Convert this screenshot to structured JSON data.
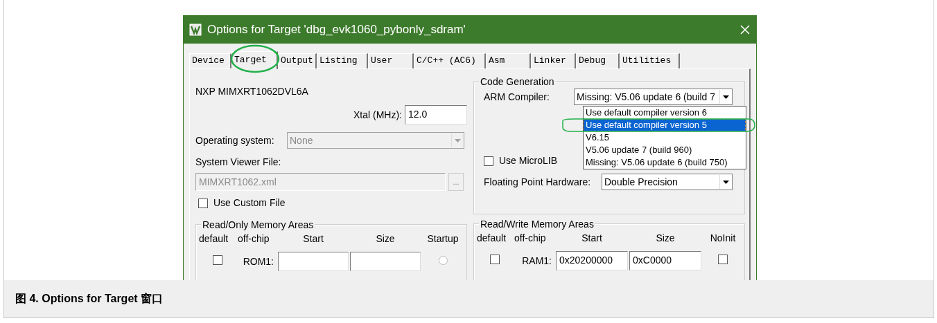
{
  "dialog": {
    "title": "Options for Target 'dbg_evk1060_pybonly_sdram'",
    "tabs": [
      {
        "label": "Device",
        "selected": false
      },
      {
        "label": "Target",
        "selected": true
      },
      {
        "label": "Output",
        "selected": false
      },
      {
        "label": "Listing",
        "selected": false
      },
      {
        "label": "User",
        "selected": false
      },
      {
        "label": "C/C++ (AC6)",
        "selected": false
      },
      {
        "label": "Asm",
        "selected": false
      },
      {
        "label": "Linker",
        "selected": false
      },
      {
        "label": "Debug",
        "selected": false
      },
      {
        "label": "Utilities",
        "selected": false
      }
    ],
    "device": "NXP MIMXRT1062DVL6A",
    "xtal": {
      "label": "Xtal (MHz):",
      "value": "12.0"
    },
    "operating_system": {
      "label": "Operating system:",
      "value": "None",
      "disabled": true
    },
    "system_viewer": {
      "label": "System Viewer File:",
      "value": "MIMXRT1062.xml",
      "disabled": true,
      "browse": "..."
    },
    "use_custom_file": {
      "label": "Use Custom File",
      "checked": false
    },
    "code_generation": {
      "title": "Code Generation",
      "arm_compiler": {
        "label": "ARM Compiler:",
        "value": "Missing: V5.06 update 6 (build 7",
        "options": [
          {
            "label": "Use default compiler version 6",
            "selected": false
          },
          {
            "label": "Use default compiler version 5",
            "selected": true
          },
          {
            "label": "V6.15",
            "selected": false
          },
          {
            "label": "V5.06 update 7 (build 960)",
            "selected": false
          },
          {
            "label": "Missing: V5.06 update 6 (build 750)",
            "selected": false
          }
        ]
      },
      "use_microlib": {
        "label": "Use MicroLIB",
        "checked": false
      },
      "fpu": {
        "label": "Floating Point Hardware:",
        "value": "Double Precision"
      }
    },
    "rom_areas": {
      "title": "Read/Only Memory Areas",
      "columns": [
        "default",
        "off-chip",
        "Start",
        "Size",
        "Startup"
      ],
      "rows": [
        {
          "default": false,
          "name": "ROM1:",
          "startup": false
        }
      ]
    },
    "ram_areas": {
      "title": "Read/Write Memory Areas",
      "columns": [
        "default",
        "off-chip",
        "Start",
        "Size",
        "NoInit"
      ],
      "rows": [
        {
          "default": false,
          "name": "RAM1:",
          "start": "0x20200000",
          "size": "0xC0000",
          "noinit": false
        }
      ]
    }
  },
  "caption": "图 4. Options for Target 窗口"
}
